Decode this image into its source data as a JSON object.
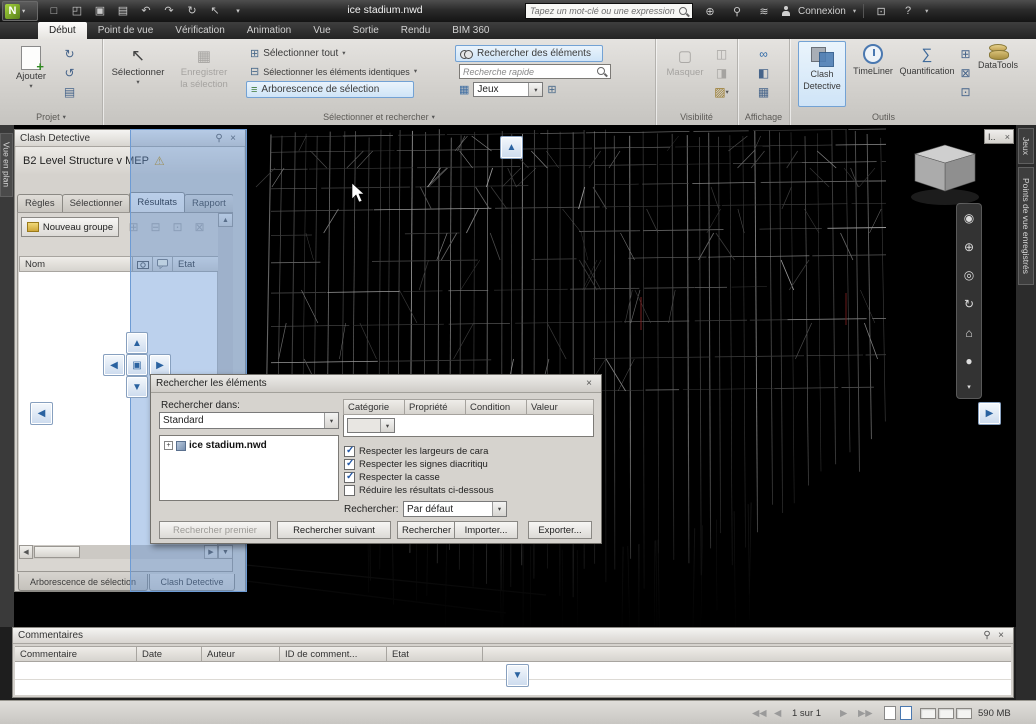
{
  "titlebar": {
    "title": "ice stadium.nwd",
    "search_placeholder": "Tapez un mot-clé ou une expression",
    "connexion_label": "Connexion",
    "help_label": "?"
  },
  "ribbon": {
    "tabs": [
      "Début",
      "Point de vue",
      "Vérification",
      "Animation",
      "Vue",
      "Sortie",
      "Rendu",
      "BIM 360"
    ],
    "groups": {
      "projet": "Projet",
      "selection": "Sélectionner et rechercher",
      "visibilite": "Visibilité",
      "affichage": "Affichage",
      "outils": "Outils"
    },
    "projet": {
      "ajouter": "Ajouter"
    },
    "selection": {
      "selectionner": "Sélectionner",
      "enregistrer_line1": "Enregistrer",
      "enregistrer_line2": "la sélection",
      "selectionner_tout": "Sélectionner tout",
      "selectionner_identiques": "Sélectionner les éléments identiques",
      "arborescence": "Arborescence de sélection",
      "rechercher_elements": "Rechercher des éléments",
      "recherche_rapide_placeholder": "Recherche rapide",
      "jeux": "Jeux"
    },
    "visibilite": {
      "masquer": "Masquer"
    },
    "outils": {
      "clash_line1": "Clash",
      "clash_line2": "Detective",
      "timeliner": "TimeLiner",
      "quantification": "Quantification",
      "datatools": "DataTools"
    }
  },
  "clash_panel": {
    "title": "Clash Detective",
    "test_name": "B2 Level Structure v MEP",
    "tabs": [
      "Règles",
      "Sélectionner",
      "Résultats",
      "Rapport"
    ],
    "nouveau_groupe": "Nouveau groupe",
    "columns": {
      "nom": "Nom",
      "etat": "Etat"
    },
    "bottom_tabs": [
      "Arborescence de sélection",
      "Clash Detective"
    ]
  },
  "find_dialog": {
    "title": "Rechercher les éléments",
    "search_in_label": "Rechercher dans:",
    "search_in_value": "Standard",
    "tree_item": "ice stadium.nwd",
    "table_columns": [
      "Catégorie",
      "Propriété",
      "Condition",
      "Valeur"
    ],
    "options": [
      {
        "label": "Respecter les largeurs de cara",
        "checked": true
      },
      {
        "label": "Respecter les signes diacritiqu",
        "checked": true
      },
      {
        "label": "Respecter la casse",
        "checked": true
      },
      {
        "label": "Réduire les résultats ci-dessous",
        "checked": false
      }
    ],
    "rechercher_label": "Rechercher:",
    "rechercher_value": "Par défaut",
    "buttons": {
      "premier": "Rechercher premier",
      "suivant": "Rechercher suivant",
      "tout": "Rechercher tout",
      "importer": "Importer...",
      "exporter": "Exporter..."
    }
  },
  "comments_panel": {
    "title": "Commentaires",
    "columns": [
      "Commentaire",
      "Date",
      "Auteur",
      "ID de comment...",
      "Etat"
    ]
  },
  "status_bar": {
    "page": "1 sur 1",
    "memory": "590 MB"
  },
  "side_tabs": {
    "left": "Vue en plan",
    "right": [
      "Jeux",
      "Points de vue enregistrés"
    ],
    "collapsed_panel": "I.."
  }
}
